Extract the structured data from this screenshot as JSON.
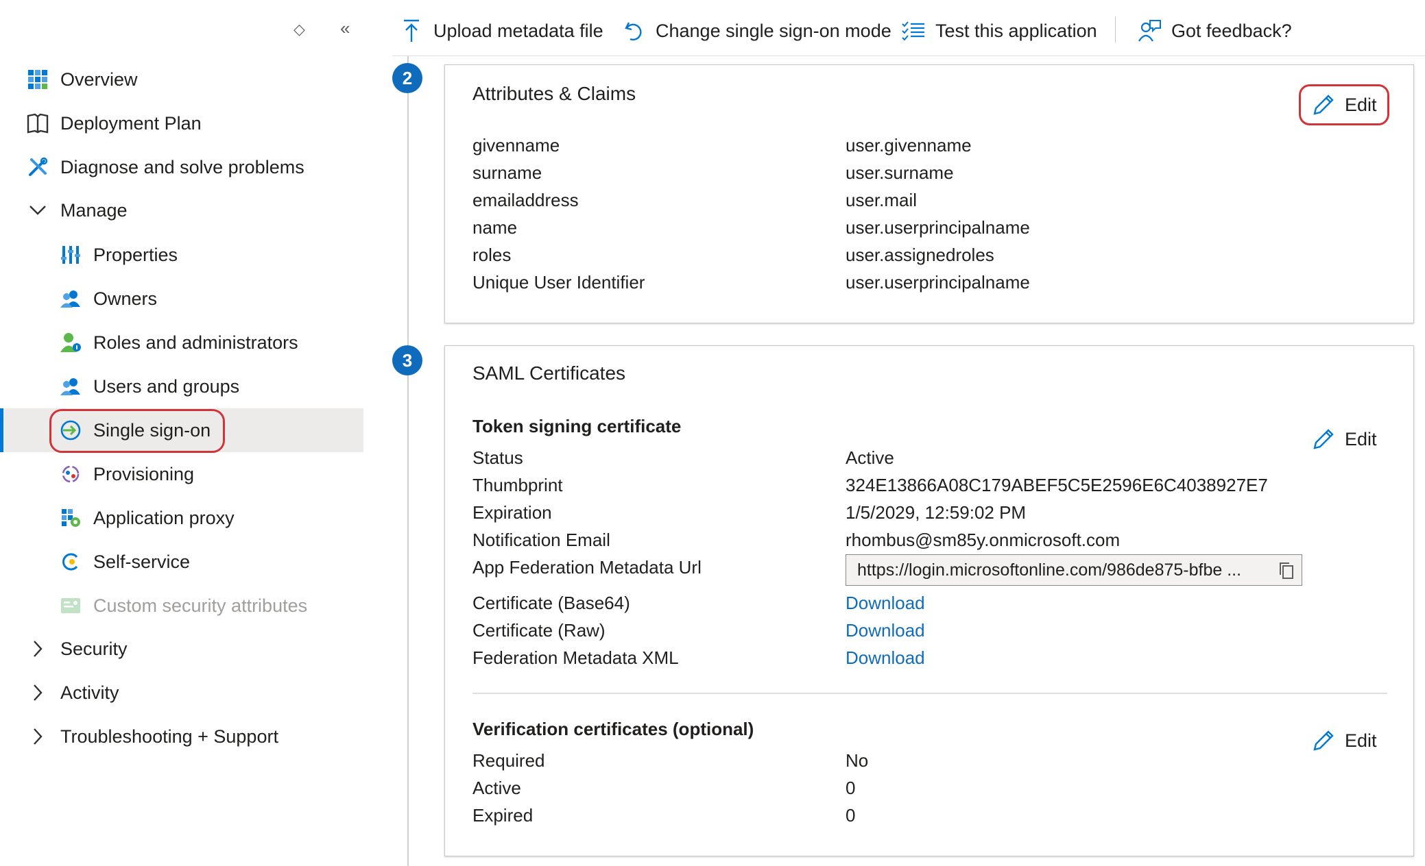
{
  "sidebar": {
    "items": [
      {
        "label": "Overview"
      },
      {
        "label": "Deployment Plan"
      },
      {
        "label": "Diagnose and solve problems"
      },
      {
        "label": "Manage"
      },
      {
        "label": "Properties"
      },
      {
        "label": "Owners"
      },
      {
        "label": "Roles and administrators"
      },
      {
        "label": "Users and groups"
      },
      {
        "label": "Single sign-on"
      },
      {
        "label": "Provisioning"
      },
      {
        "label": "Application proxy"
      },
      {
        "label": "Self-service"
      },
      {
        "label": "Custom security attributes"
      },
      {
        "label": "Security"
      },
      {
        "label": "Activity"
      },
      {
        "label": "Troubleshooting + Support"
      }
    ]
  },
  "toolbar": {
    "upload_label": "Upload metadata file",
    "change_label": "Change single sign-on mode",
    "test_label": "Test this application",
    "feedback_label": "Got feedback?"
  },
  "steps": {
    "two": "2",
    "three": "3"
  },
  "attributes": {
    "title": "Attributes & Claims",
    "edit_label": "Edit",
    "rows": [
      {
        "k": "givenname",
        "v": "user.givenname"
      },
      {
        "k": "surname",
        "v": "user.surname"
      },
      {
        "k": "emailaddress",
        "v": "user.mail"
      },
      {
        "k": "name",
        "v": "user.userprincipalname"
      },
      {
        "k": "roles",
        "v": "user.assignedroles"
      },
      {
        "k": "Unique User Identifier",
        "v": "user.userprincipalname"
      }
    ]
  },
  "saml": {
    "title": "SAML Certificates",
    "token": {
      "heading": "Token signing certificate",
      "edit_label": "Edit",
      "status_k": "Status",
      "status_v": "Active",
      "thumb_k": "Thumbprint",
      "thumb_v": "324E13866A08C179ABEF5C5E2596E6C4038927E7",
      "exp_k": "Expiration",
      "exp_v": "1/5/2029, 12:59:02 PM",
      "email_k": "Notification Email",
      "email_v": "rhombus@sm85y.onmicrosoft.com",
      "url_k": "App Federation Metadata Url",
      "url_v": "https://login.microsoftonline.com/986de875-bfbe ...",
      "b64_k": "Certificate (Base64)",
      "b64_v": "Download",
      "raw_k": "Certificate (Raw)",
      "raw_v": "Download",
      "xml_k": "Federation Metadata XML",
      "xml_v": "Download"
    },
    "verification": {
      "heading": "Verification certificates (optional)",
      "edit_label": "Edit",
      "req_k": "Required",
      "req_v": "No",
      "active_k": "Active",
      "active_v": "0",
      "expired_k": "Expired",
      "expired_v": "0"
    }
  },
  "colors": {
    "accent": "#0f6cbd",
    "highlight": "#d13438",
    "selected_bg": "#edebe9"
  }
}
